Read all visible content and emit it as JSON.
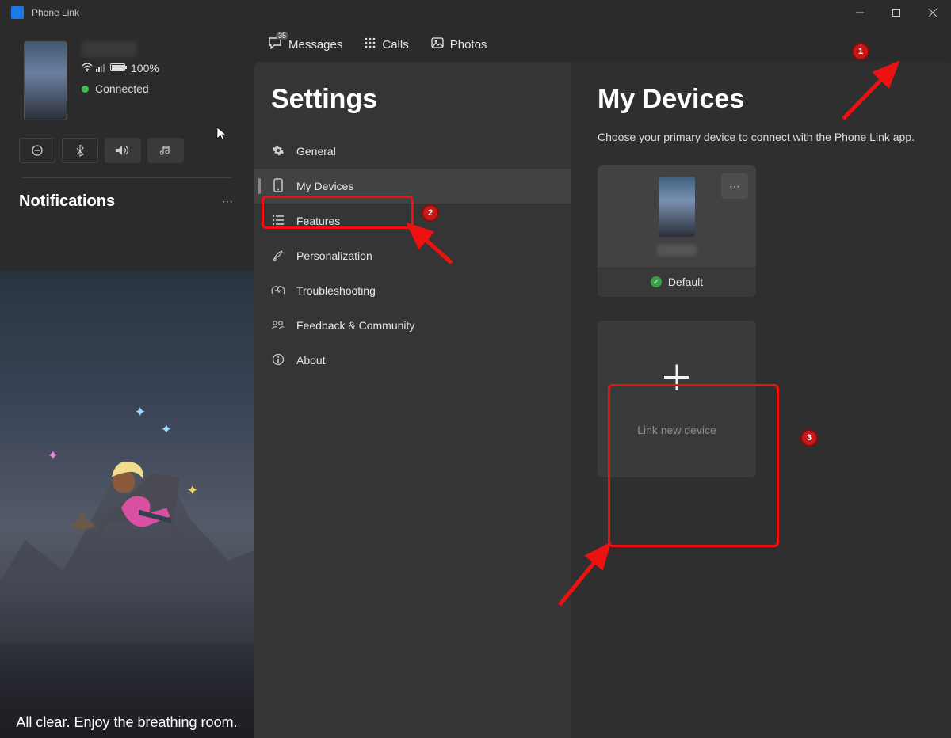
{
  "app": {
    "title": "Phone Link"
  },
  "phone": {
    "battery": "100%",
    "status": "Connected"
  },
  "tabs": {
    "messages": "Messages",
    "messages_badge": "35",
    "calls": "Calls",
    "photos": "Photos"
  },
  "side": {
    "notifications_title": "Notifications",
    "empty_msg": "All clear. Enjoy the breathing room."
  },
  "settings": {
    "title": "Settings",
    "items": {
      "general": "General",
      "my_devices": "My Devices",
      "features": "Features",
      "personalization": "Personalization",
      "troubleshooting": "Troubleshooting",
      "feedback": "Feedback & Community",
      "about": "About"
    }
  },
  "devices": {
    "title": "My Devices",
    "subtitle": "Choose your primary device to connect with the Phone Link app.",
    "default_label": "Default",
    "link_label": "Link new device"
  },
  "annotations": {
    "n1": "1",
    "n2": "2",
    "n3": "3"
  }
}
